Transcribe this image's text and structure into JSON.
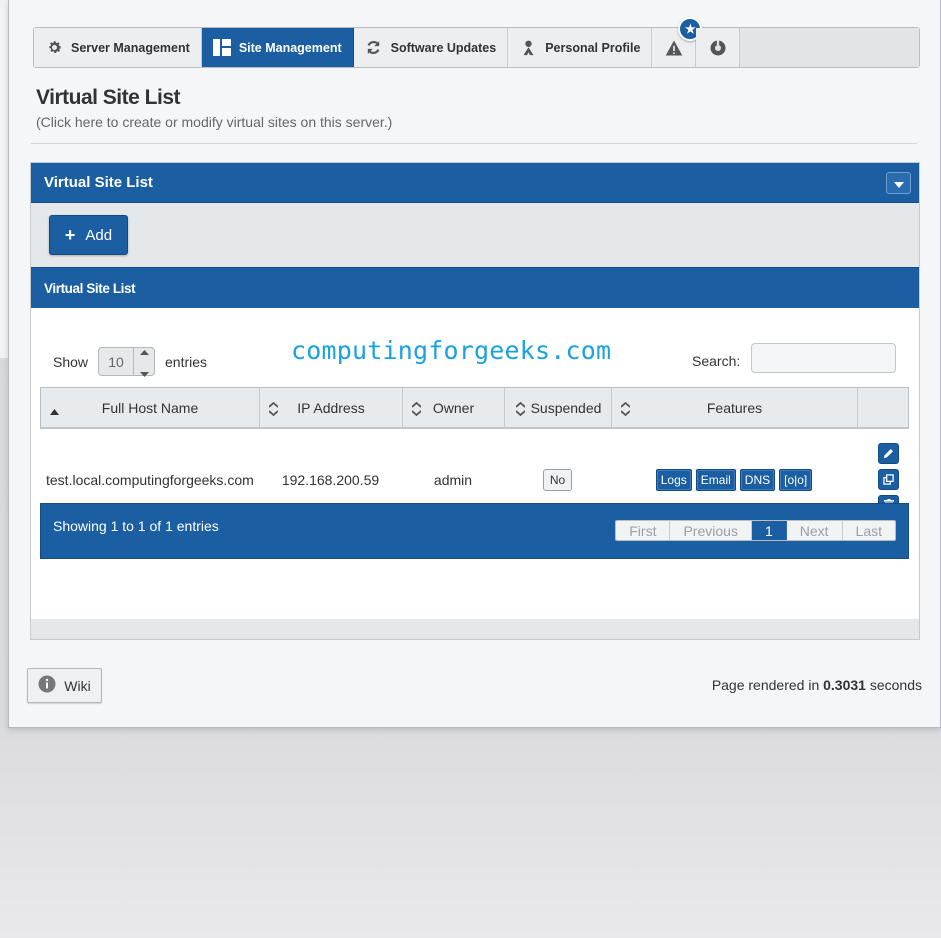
{
  "nav": {
    "tabs": [
      {
        "label": "Server Management",
        "icon": "gear-icon"
      },
      {
        "label": "Site Management",
        "icon": "layout-icon",
        "active": true
      },
      {
        "label": "Software Updates",
        "icon": "refresh-icon"
      },
      {
        "label": "Personal Profile",
        "icon": "user-icon"
      }
    ],
    "alert_icon": "warning-icon",
    "lifebuoy_icon": "help-icon",
    "badge_icon": "star-icon"
  },
  "page": {
    "title": "Virtual Site List",
    "subtitle": "(Click here to create or modify virtual sites on this server.)"
  },
  "panel": {
    "title": "Virtual Site List",
    "add_label": "Add",
    "inner_title": "Virtual Site List"
  },
  "table_controls": {
    "show_label": "Show",
    "page_length": "10",
    "entries_label": "entries",
    "search_label": "Search:",
    "search_value": ""
  },
  "watermark": "computingforgeeks.com",
  "table": {
    "columns": [
      "Full Host Name",
      "IP Address",
      "Owner",
      "Suspended",
      "Features",
      ""
    ],
    "rows": [
      {
        "host": "test.local.computingforgeeks.com",
        "ip": "192.168.200.59",
        "owner": "admin",
        "suspended": "No",
        "features": [
          "Logs",
          "Email",
          "DNS",
          "[o|o]"
        ]
      }
    ]
  },
  "footer": {
    "info": "Showing 1 to 1 of 1 entries",
    "pager": [
      "First",
      "Previous",
      "1",
      "Next",
      "Last"
    ],
    "current_page": "1"
  },
  "bottom": {
    "wiki_label": "Wiki",
    "rendered_prefix": "Page rendered in",
    "rendered_value": "0.3031",
    "rendered_suffix": "seconds"
  },
  "colors": {
    "primary": "#1b5ea2",
    "watermark": "#1aa1e0"
  }
}
